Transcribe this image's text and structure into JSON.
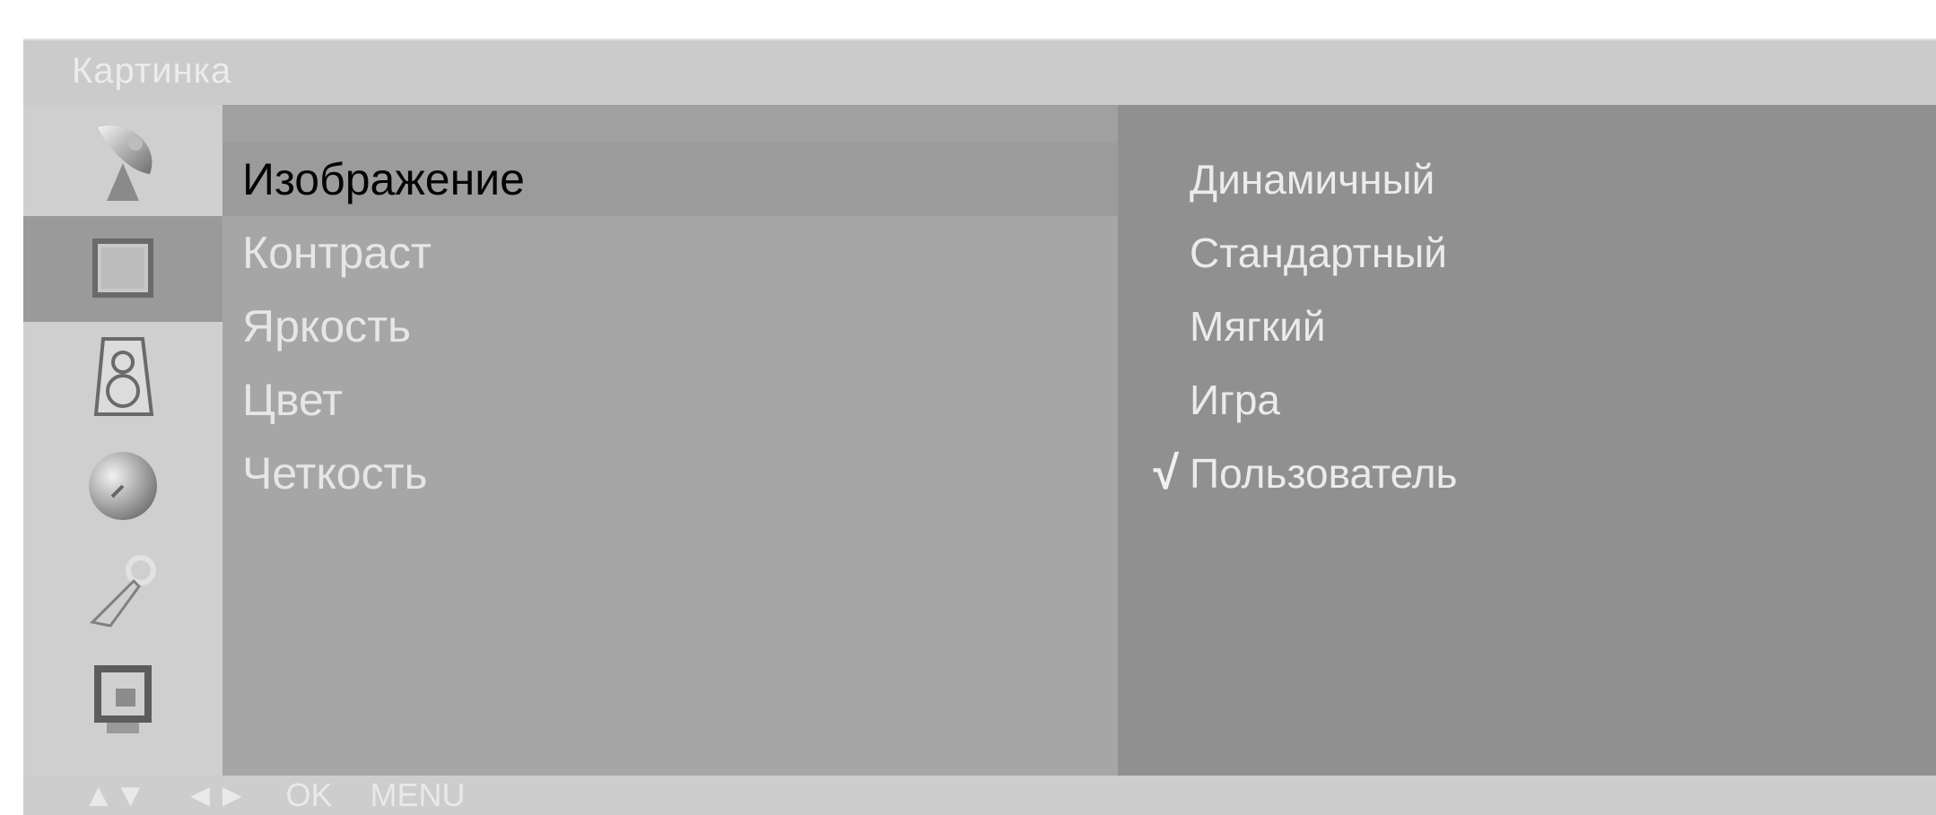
{
  "window": {
    "title": "Картинка"
  },
  "icons": [
    {
      "name": "satellite-dish-icon",
      "selected": false
    },
    {
      "name": "picture-icon",
      "selected": true
    },
    {
      "name": "speaker-icon",
      "selected": false
    },
    {
      "name": "clock-icon",
      "selected": false
    },
    {
      "name": "key-icon",
      "selected": false
    },
    {
      "name": "monitor-input-icon",
      "selected": false
    }
  ],
  "menu": {
    "items": [
      {
        "label": "Изображение",
        "active": true
      },
      {
        "label": "Контраст",
        "active": false
      },
      {
        "label": "Яркость",
        "active": false
      },
      {
        "label": "Цвет",
        "active": false
      },
      {
        "label": "Четкость",
        "active": false
      }
    ]
  },
  "options": {
    "items": [
      {
        "label": "Динамичный",
        "checked": false
      },
      {
        "label": "Стандартный",
        "checked": false
      },
      {
        "label": "Мягкий",
        "checked": false
      },
      {
        "label": "Игра",
        "checked": false
      },
      {
        "label": "Пользователь",
        "checked": true
      }
    ],
    "check_symbol": "√"
  },
  "footer": {
    "hints": [
      "▲▼",
      "◄►",
      "OK",
      "MENU"
    ]
  }
}
